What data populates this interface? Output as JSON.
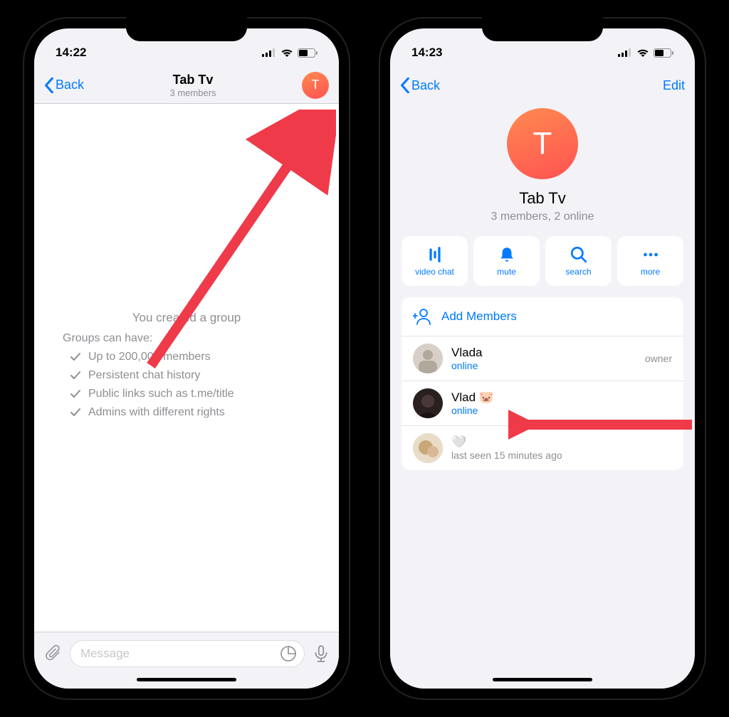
{
  "left": {
    "time": "14:22",
    "back": "Back",
    "title": "Tab Tv",
    "subtitle": "3 members",
    "avatar_letter": "T",
    "placeholder_title": "You created a group",
    "placeholder_sub": "Groups can have:",
    "bullets": [
      "Up to 200,000 members",
      "Persistent chat history",
      "Public links such as t.me/title",
      "Admins with different rights"
    ],
    "compose_placeholder": "Message"
  },
  "right": {
    "time": "14:23",
    "back": "Back",
    "edit": "Edit",
    "avatar_letter": "T",
    "name": "Tab Tv",
    "subtitle": "3 members, 2 online",
    "actions": {
      "video": "video chat",
      "mute": "mute",
      "search": "search",
      "more": "more"
    },
    "add_members": "Add Members",
    "members": [
      {
        "name": "Vlada",
        "status": "online",
        "role": "owner",
        "online": true
      },
      {
        "name": "Vlad 🐷",
        "status": "online",
        "role": "",
        "online": true
      },
      {
        "name": "🤍",
        "status": "last seen 15 minutes ago",
        "role": "",
        "online": false
      }
    ]
  }
}
